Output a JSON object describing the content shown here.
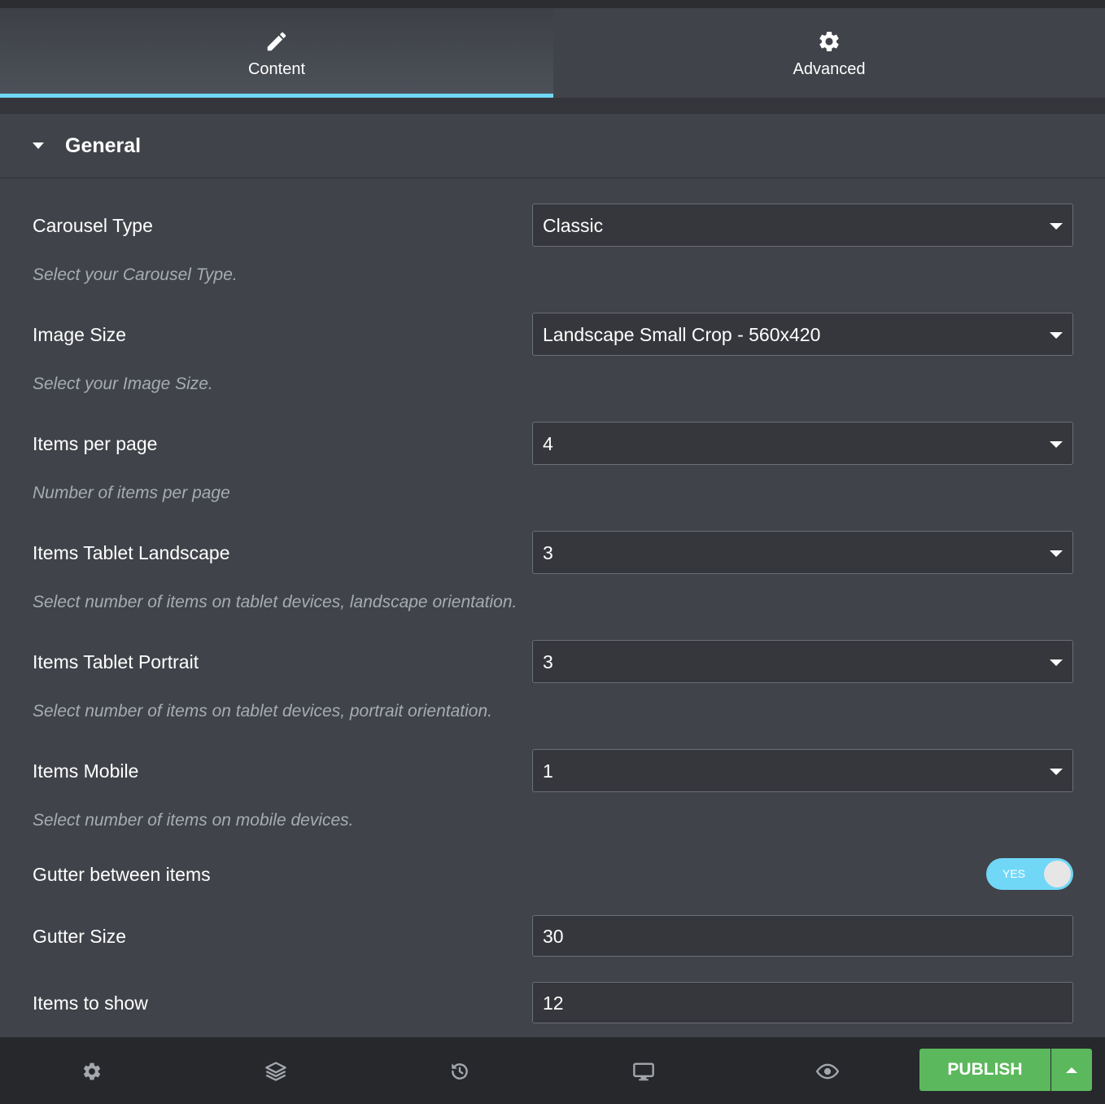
{
  "tabs": [
    {
      "label": "Content",
      "icon": "pencil-icon",
      "active": true
    },
    {
      "label": "Advanced",
      "icon": "gear-icon",
      "active": false
    }
  ],
  "section": {
    "title": "General"
  },
  "fields": [
    {
      "label": "Carousel Type",
      "value": "Classic",
      "description": "Select your Carousel Type."
    },
    {
      "label": "Image Size",
      "value": "Landscape Small Crop - 560x420",
      "description": "Select your Image Size."
    },
    {
      "label": "Items per page",
      "value": "4",
      "description": "Number of items per page"
    },
    {
      "label": "Items Tablet Landscape",
      "value": "3",
      "description": "Select number of items on tablet devices, landscape orientation."
    },
    {
      "label": "Items Tablet Portrait",
      "value": "3",
      "description": "Select number of items on tablet devices, portrait orientation."
    },
    {
      "label": "Items Mobile",
      "value": "1",
      "description": "Select number of items on mobile devices."
    }
  ],
  "gutter": {
    "label": "Gutter between items",
    "toggle_label": "YES",
    "enabled": true
  },
  "gutter_size": {
    "label": "Gutter Size",
    "value": "30"
  },
  "items_to_show": {
    "label": "Items to show",
    "value": "12"
  },
  "footer": {
    "icons": [
      "gear-icon",
      "layers-icon",
      "history-icon",
      "desktop-icon",
      "eye-icon"
    ],
    "publish_label": "PUBLISH"
  },
  "colors": {
    "accent": "#71d7f7",
    "publish": "#5cb85c",
    "panel": "#404349"
  }
}
